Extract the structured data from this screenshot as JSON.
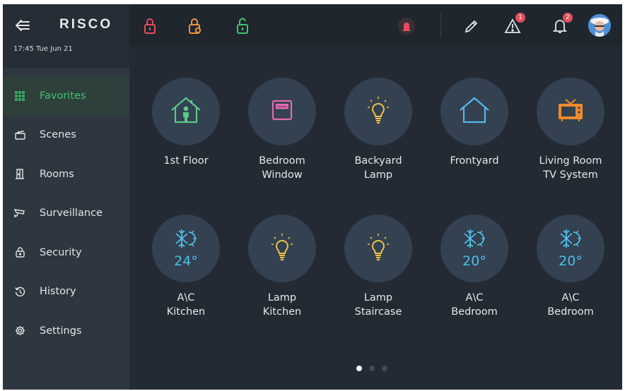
{
  "header": {
    "logo": "RISCO",
    "datetime": "17:45 Tue Jun 21"
  },
  "nav": [
    {
      "id": "favorites",
      "label": "Favorites",
      "icon": "grid-icon",
      "active": true
    },
    {
      "id": "scenes",
      "label": "Scenes",
      "icon": "clapperboard-icon"
    },
    {
      "id": "rooms",
      "label": "Rooms",
      "icon": "door-icon"
    },
    {
      "id": "surveillance",
      "label": "Surveillance",
      "icon": "camera-icon"
    },
    {
      "id": "security",
      "label": "Security",
      "icon": "lock-icon"
    },
    {
      "id": "history",
      "label": "History",
      "icon": "history-icon"
    },
    {
      "id": "settings",
      "label": "Settings",
      "icon": "gear-icon"
    }
  ],
  "topbar": {
    "alerts_badge": "1",
    "notifications_badge": "2"
  },
  "favorites": [
    {
      "label": "1st Floor",
      "icon": "house-person-icon"
    },
    {
      "label": "Bedroom\nWindow",
      "icon": "window-icon"
    },
    {
      "label": "Backyard\nLamp",
      "icon": "lamp-icon"
    },
    {
      "label": "Frontyard",
      "icon": "house-icon"
    },
    {
      "label": "Living Room\nTV System",
      "icon": "tv-icon"
    },
    {
      "label": "A\\C\nKitchen",
      "icon": "ac-icon",
      "temp": "24°"
    },
    {
      "label": "Lamp\nKitchen",
      "icon": "lamp-icon"
    },
    {
      "label": "Lamp\nStaircase",
      "icon": "lamp-icon"
    },
    {
      "label": "A\\C\nBedroom",
      "icon": "ac-icon",
      "temp": "20°"
    },
    {
      "label": "A\\C\nBedroom",
      "icon": "ac-icon",
      "temp": "20°"
    }
  ],
  "colors": {
    "accent": "#3fc56e",
    "lamp": "#f0c445",
    "house": "#5cc88a",
    "window": "#e36ab0",
    "frontyard": "#5ab5ec",
    "tv": "#f08a2c",
    "ac": "#4ec0ea",
    "lock_red": "#e84a5f",
    "lock_orange": "#f0923a",
    "lock_green": "#3fc56e"
  },
  "pagination": {
    "pages": 3,
    "current": 0
  }
}
